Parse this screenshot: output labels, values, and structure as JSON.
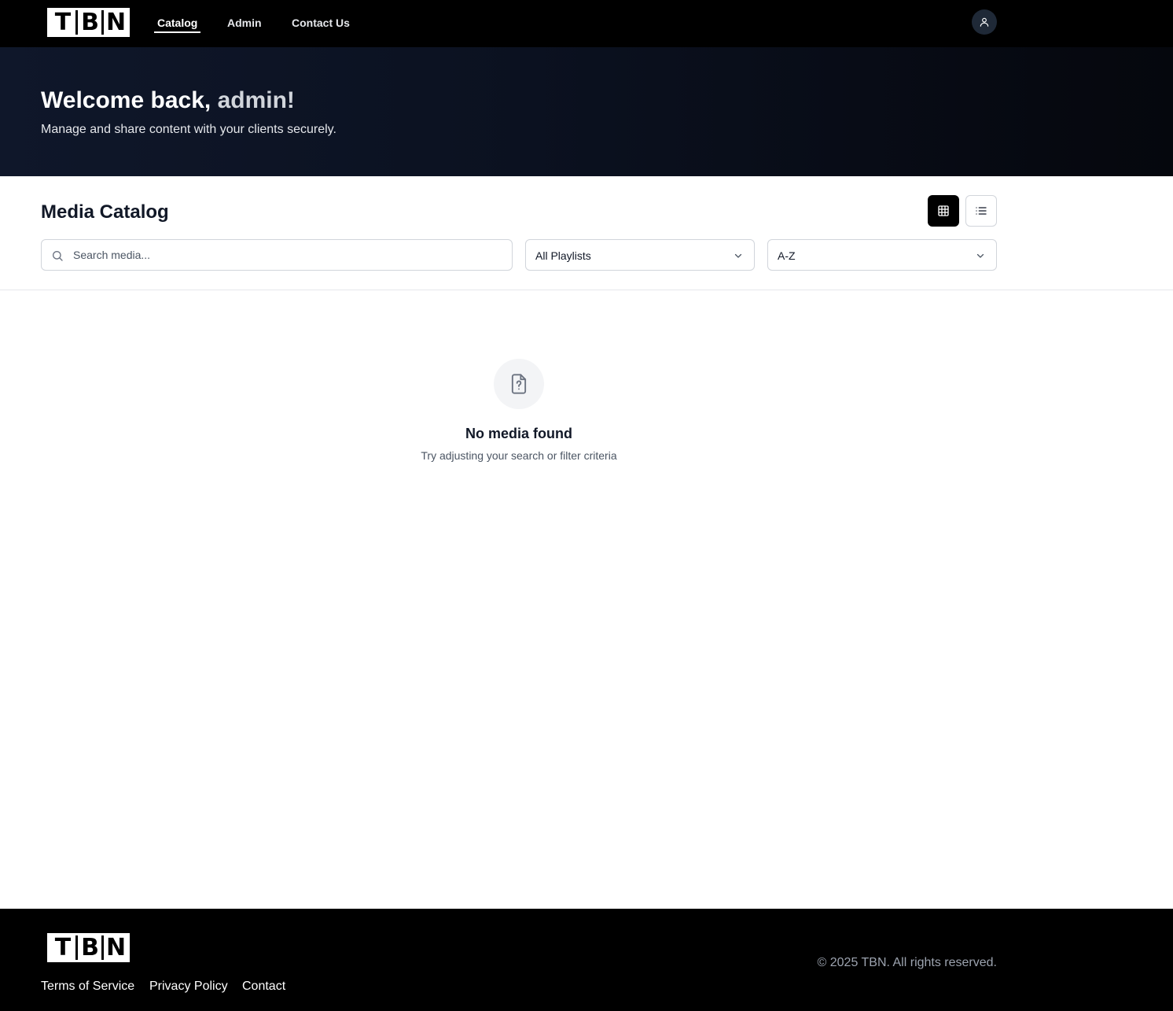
{
  "brand": {
    "letters": [
      "T",
      "B",
      "N"
    ]
  },
  "nav": {
    "links": [
      {
        "label": "Catalog",
        "active": true
      },
      {
        "label": "Admin",
        "active": false
      },
      {
        "label": "Contact Us",
        "active": false
      }
    ],
    "user_icon": "user-icon"
  },
  "hero": {
    "greeting": "Welcome back,",
    "username": "admin!",
    "subtitle": "Manage and share content with your clients securely."
  },
  "catalog": {
    "title": "Media Catalog",
    "view_modes": {
      "grid_icon": "grid-icon",
      "list_icon": "list-icon",
      "selected": "grid"
    },
    "search": {
      "placeholder": "Search media...",
      "value": ""
    },
    "playlist_filter": {
      "selected": "All Playlists"
    },
    "sort": {
      "selected": "A-Z"
    }
  },
  "empty_state": {
    "icon": "file-question-icon",
    "title": "No media found",
    "message": "Try adjusting your search or filter criteria"
  },
  "footer": {
    "links": [
      "Terms of Service",
      "Privacy Policy",
      "Contact"
    ],
    "copyright": "© 2025 TBN. All rights reserved."
  },
  "colors": {
    "nav_bg": "#000000",
    "hero_bg": "#0f172a",
    "accent": "#000000",
    "muted_text": "#4b5563"
  }
}
